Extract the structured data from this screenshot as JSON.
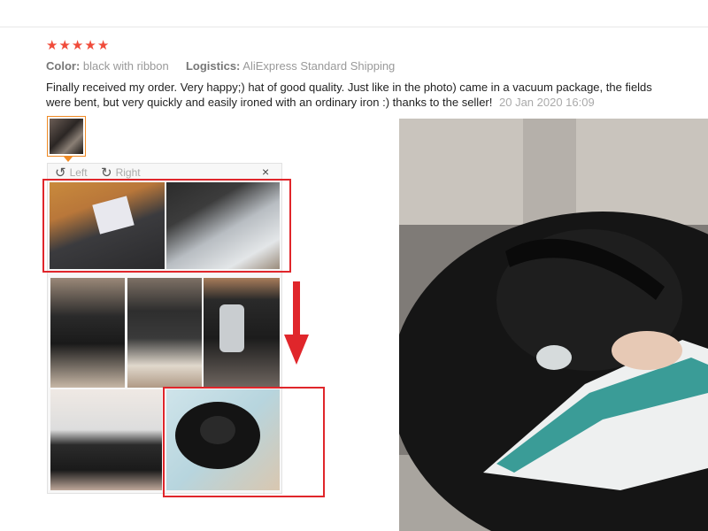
{
  "review": {
    "stars": [
      "★",
      "★",
      "★",
      "★",
      "★"
    ],
    "rating": 5,
    "color_label": "Color:",
    "color_value": "black with ribbon",
    "logistics_label": "Logistics:",
    "logistics_value": "AliExpress Standard Shipping",
    "text": "Finally received my order. Very happy;) hat of good quality. Just like in the photo) came in a vacuum package, the fields were bent, but very quickly and easily ironed with an ordinary iron :) thanks to the seller!",
    "date": "20 Jan 2020 16:09"
  },
  "viewer": {
    "rotate_left_label": "Left",
    "rotate_right_label": "Right",
    "close_glyph": "×",
    "rotate_left_icon": "↺",
    "rotate_right_icon": "↻"
  },
  "colors": {
    "star": "#f04b3a",
    "highlight": "#e0262b",
    "thumb_border": "#f08a24"
  }
}
